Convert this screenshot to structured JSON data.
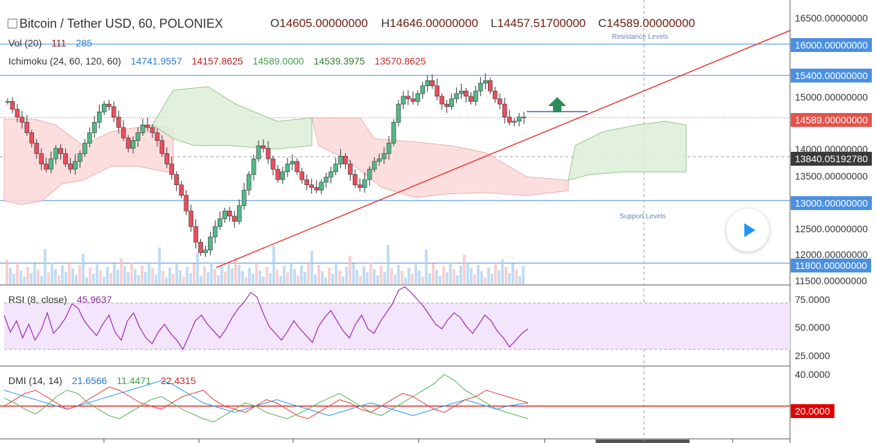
{
  "header": {
    "symbol_title": "Bitcoin / Tether USD, 60, POLONIEX",
    "ohlc": [
      {
        "key": "O",
        "value": "14605.00000000"
      },
      {
        "key": "H",
        "value": "14646.00000000"
      },
      {
        "key": "L",
        "value": "14457.51700000"
      },
      {
        "key": "C",
        "value": "14589.00000000"
      }
    ]
  },
  "indicators": {
    "vol": {
      "label": "Vol (20)",
      "v1": "111",
      "v2": "285"
    },
    "ichimoku": {
      "label": "Ichimoku (24, 60, 120, 60)",
      "v1": "14741.9557",
      "v2": "14157.8625",
      "v3": "14589.0000",
      "v4": "14539.3975",
      "v5": "13570.8625"
    },
    "rsi": {
      "label": "RSI (8, close)",
      "value": "45.9637"
    },
    "dmi": {
      "label": "DMI (14, 14)",
      "v1": "21.6566",
      "v2": "11.4471",
      "v3": "22.4315"
    }
  },
  "annotations": {
    "resistance": "Resistance Levels",
    "support": "Support Levels"
  },
  "price_axis": {
    "ticks": [
      "16500.00000000",
      "15000.00000000",
      "14000.00000000",
      "13500.00000000",
      "12500.00000000",
      "12000.00000000",
      "11500.00000000"
    ],
    "tags": [
      {
        "text": "16000.00000000",
        "kind": "level"
      },
      {
        "text": "15400.00000000",
        "kind": "level"
      },
      {
        "text": "14589.00000000",
        "kind": "last"
      },
      {
        "text": "13840.05192780",
        "kind": "cross"
      },
      {
        "text": "13000.00000000",
        "kind": "level"
      },
      {
        "text": "11800.00000000",
        "kind": "level"
      }
    ]
  },
  "rsi_axis": {
    "ticks": [
      "75.0000",
      "50.0000",
      "25.0000"
    ]
  },
  "dmi_axis": {
    "ticks": [
      "40.0000"
    ],
    "tag": "20.0000"
  },
  "colors": {
    "up": "#53b987",
    "down": "#eb4d5c",
    "level_line": "#4a90e2",
    "trend_line": "#e53935",
    "rsi": "#9c27b0",
    "rsi_band": "#f3e5fc",
    "dmi_plus": "#4caf50",
    "dmi_minus": "#e53935",
    "adx": "#2196f3",
    "last_price": "#e5534b",
    "crosshair": "#3a3a3a"
  },
  "chart_data": {
    "type": "candlestick",
    "title": "Bitcoin / Tether USD, 60, POLONIEX",
    "ylim": [
      11500,
      16600
    ],
    "horizontal_levels": [
      16000,
      15400,
      13000,
      11800
    ],
    "last_price": 14589,
    "crosshair_price": 13840.0519278,
    "close_series": [
      14900,
      14750,
      14600,
      14500,
      14300,
      14100,
      13900,
      13700,
      13600,
      13800,
      14000,
      13900,
      13700,
      13600,
      13750,
      13900,
      14100,
      14300,
      14500,
      14700,
      14850,
      14800,
      14600,
      14400,
      14200,
      14000,
      14150,
      14300,
      14450,
      14400,
      14300,
      14150,
      13900,
      13700,
      13500,
      13300,
      13100,
      12800,
      12500,
      12200,
      12000,
      12050,
      12300,
      12500,
      12650,
      12800,
      12700,
      12600,
      12900,
      13200,
      13500,
      13800,
      14050,
      14000,
      13800,
      13600,
      13400,
      13550,
      13700,
      13750,
      13550,
      13400,
      13300,
      13250,
      13200,
      13350,
      13450,
      13550,
      13700,
      13850,
      13700,
      13500,
      13300,
      13250,
      13400,
      13600,
      13750,
      13800,
      13900,
      14100,
      14500,
      14850,
      15000,
      14950,
      14900,
      15050,
      15200,
      15300,
      15200,
      15000,
      14850,
      14800,
      14950,
      15050,
      15100,
      15000,
      14900,
      15100,
      15250,
      15300,
      15100,
      14950,
      14850,
      14600,
      14500,
      14520,
      14600,
      14589
    ],
    "rsi_series": [
      60,
      45,
      55,
      40,
      52,
      38,
      47,
      62,
      44,
      50,
      58,
      70,
      66,
      55,
      48,
      42,
      52,
      60,
      45,
      38,
      55,
      62,
      49,
      40,
      35,
      45,
      52,
      44,
      38,
      30,
      42,
      55,
      60,
      52,
      46,
      40,
      48,
      58,
      66,
      72,
      80,
      76,
      62,
      50,
      44,
      38,
      46,
      55,
      48,
      42,
      36,
      50,
      58,
      64,
      55,
      46,
      40,
      52,
      60,
      48,
      44,
      54,
      62,
      70,
      82,
      85,
      80,
      74,
      68,
      60,
      52,
      48,
      56,
      62,
      58,
      50,
      44,
      52,
      60,
      55,
      46,
      40,
      32,
      38,
      44,
      48
    ],
    "dmi_plus": [
      25,
      22,
      18,
      15,
      20,
      26,
      30,
      28,
      22,
      18,
      14,
      12,
      16,
      20,
      24,
      26,
      22,
      18,
      15,
      12,
      10,
      14,
      18,
      22,
      20,
      16,
      14,
      12,
      15,
      18,
      22,
      25,
      28,
      24,
      20,
      16,
      14,
      18,
      22,
      26,
      30,
      34,
      40,
      36,
      30,
      26,
      22,
      18,
      16,
      14,
      12
    ],
    "dmi_minus": [
      20,
      24,
      28,
      30,
      26,
      22,
      18,
      20,
      24,
      28,
      32,
      30,
      26,
      22,
      20,
      18,
      22,
      26,
      28,
      30,
      24,
      20,
      18,
      16,
      20,
      24,
      22,
      18,
      14,
      12,
      16,
      20,
      24,
      22,
      18,
      16,
      20,
      24,
      28,
      26,
      22,
      18,
      16,
      20,
      24,
      26,
      30,
      28,
      26,
      24,
      22
    ],
    "adx": [
      30,
      28,
      26,
      24,
      22,
      20,
      18,
      20,
      22,
      24,
      26,
      28,
      30,
      32,
      34,
      36,
      34,
      30,
      26,
      22,
      20,
      18,
      16,
      18,
      20,
      22,
      24,
      22,
      20,
      18,
      16,
      14,
      16,
      18,
      20,
      22,
      20,
      18,
      16,
      14,
      16,
      18,
      20,
      22,
      24,
      22,
      20,
      18,
      20,
      21,
      22
    ]
  }
}
